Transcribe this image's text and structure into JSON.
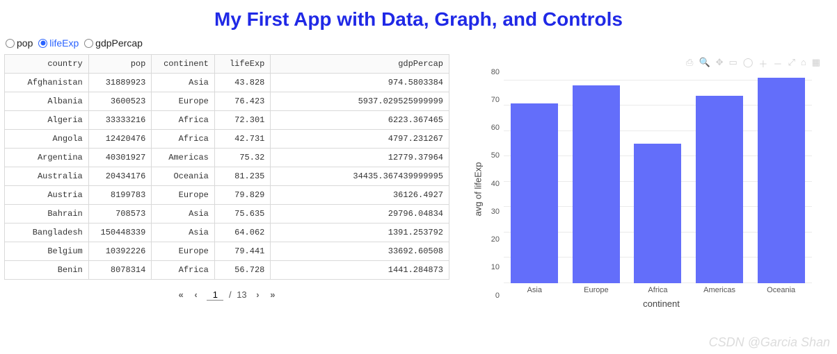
{
  "title": "My First App with Data, Graph, and Controls",
  "radio": {
    "options": [
      {
        "value": "pop",
        "label": "pop",
        "selected": false
      },
      {
        "value": "lifeExp",
        "label": "lifeExp",
        "selected": true
      },
      {
        "value": "gdpPercap",
        "label": "gdpPercap",
        "selected": false
      }
    ]
  },
  "table": {
    "columns": [
      "country",
      "pop",
      "continent",
      "lifeExp",
      "gdpPercap"
    ],
    "rows": [
      [
        "Afghanistan",
        "31889923",
        "Asia",
        "43.828",
        "974.5803384"
      ],
      [
        "Albania",
        "3600523",
        "Europe",
        "76.423",
        "5937.029525999999"
      ],
      [
        "Algeria",
        "33333216",
        "Africa",
        "72.301",
        "6223.367465"
      ],
      [
        "Angola",
        "12420476",
        "Africa",
        "42.731",
        "4797.231267"
      ],
      [
        "Argentina",
        "40301927",
        "Americas",
        "75.32",
        "12779.37964"
      ],
      [
        "Australia",
        "20434176",
        "Oceania",
        "81.235",
        "34435.367439999995"
      ],
      [
        "Austria",
        "8199783",
        "Europe",
        "79.829",
        "36126.4927"
      ],
      [
        "Bahrain",
        "708573",
        "Asia",
        "75.635",
        "29796.04834"
      ],
      [
        "Bangladesh",
        "150448339",
        "Asia",
        "64.062",
        "1391.253792"
      ],
      [
        "Belgium",
        "10392226",
        "Europe",
        "79.441",
        "33692.60508"
      ],
      [
        "Benin",
        "8078314",
        "Africa",
        "56.728",
        "1441.284873"
      ]
    ]
  },
  "pager": {
    "first": "«",
    "prev": "‹",
    "page": "1",
    "sep": "/",
    "total": "13",
    "next": "›",
    "last": "»"
  },
  "modebar": {
    "icons": [
      "camera-icon",
      "zoom-icon",
      "pan-icon",
      "box-select-icon",
      "lasso-icon",
      "zoom-in-icon",
      "zoom-out-icon",
      "autoscale-icon",
      "reset-icon",
      "plotly-logo-icon"
    ]
  },
  "chart_data": {
    "type": "bar",
    "title": "",
    "xlabel": "continent",
    "ylabel": "avg of lifeExp",
    "ylim": [
      0,
      85
    ],
    "yticks": [
      80,
      70,
      60,
      50,
      40,
      30,
      20,
      10,
      0
    ],
    "categories": [
      "Asia",
      "Europe",
      "Africa",
      "Americas",
      "Oceania"
    ],
    "values": [
      71,
      78,
      55,
      74,
      81
    ],
    "bar_color": "#636efa"
  },
  "watermark": "CSDN @Garcia Shan"
}
